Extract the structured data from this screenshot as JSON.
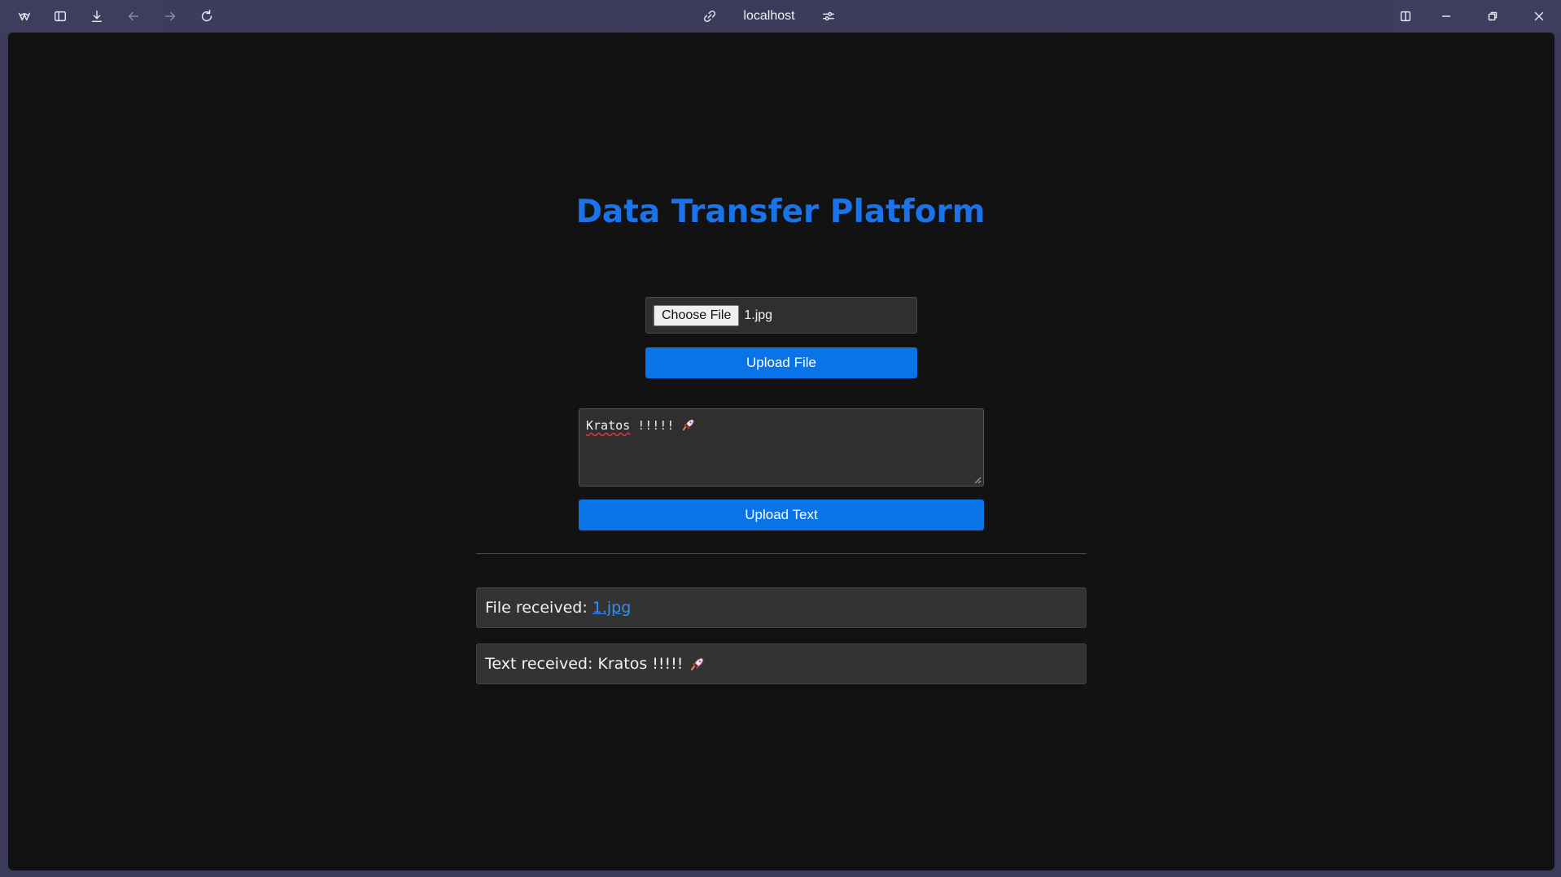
{
  "browser": {
    "url": "localhost",
    "icons": [
      "app-logo-icon",
      "sidebar-icon",
      "download-icon",
      "back-arrow-icon",
      "forward-arrow-icon",
      "reload-icon",
      "link-icon",
      "site-settings-icon",
      "split-view-icon",
      "minimize-icon",
      "restore-icon",
      "close-icon"
    ]
  },
  "page": {
    "title": "Data Transfer Platform",
    "file_input": {
      "button_label": "Choose File",
      "file_name": "1.jpg"
    },
    "upload_file_label": "Upload File",
    "text_input": {
      "word": "Kratos",
      "rest": " !!!!! ",
      "emoji": "rocket"
    },
    "upload_text_label": "Upload Text",
    "results": {
      "file_prefix": "File received:",
      "file_link": "1.jpg",
      "text_prefix": "Text received:",
      "text_value": "Kratos !!!!!"
    }
  },
  "colors": {
    "accent": "#0a73e8",
    "title": "#1a73e8",
    "background": "#121212",
    "panel": "#333333"
  }
}
